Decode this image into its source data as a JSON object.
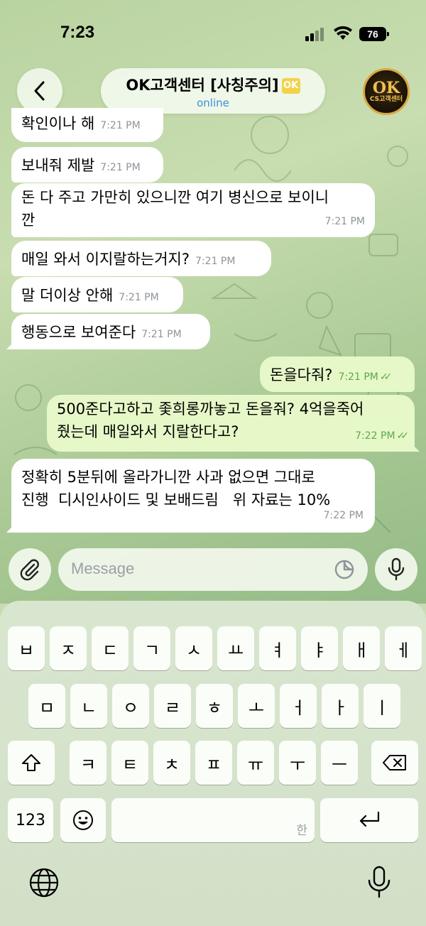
{
  "status_bar": {
    "time": "7:23",
    "battery": "76"
  },
  "header": {
    "title": "OK고객센터 [사칭주의]",
    "status": "online",
    "avatar_text": "OK",
    "avatar_sub": "CS고객센터"
  },
  "messages": [
    {
      "direction": "in",
      "text": "확인이나 해",
      "time": "7:21 PM"
    },
    {
      "direction": "in",
      "text": "보내줘 제발",
      "time": "7:21 PM"
    },
    {
      "direction": "in",
      "text": "돈 다 주고 가만히 있으니깐 여기 병신으로 보이니\n깐",
      "time": "7:21 PM"
    },
    {
      "direction": "in",
      "text": "매일 와서 이지랄하는거지?",
      "time": "7:21 PM"
    },
    {
      "direction": "in",
      "text": "말 더이상 안해",
      "time": "7:21 PM"
    },
    {
      "direction": "in",
      "text": "행동으로 보여준다",
      "time": "7:21 PM"
    },
    {
      "direction": "out",
      "text": "돈을다줘?",
      "time": "7:21 PM"
    },
    {
      "direction": "out",
      "text": "500준다고하고 좇희롱까놓고 돈을줘? 4억을죽어\n줬는데 매일와서 지랄한다고?",
      "time": "7:22 PM"
    },
    {
      "direction": "in",
      "text": "정확히 5분뒤에 올라가니깐 사과 없으면 그대로\n진행  디시인사이드 및 보배드림   위 자료는 10%",
      "time": "7:22 PM"
    }
  ],
  "input": {
    "placeholder": "Message"
  },
  "keyboard": {
    "row1": [
      "ㅂ",
      "ㅈ",
      "ㄷ",
      "ㄱ",
      "ㅅ",
      "ㅛ",
      "ㅕ",
      "ㅑ",
      "ㅐ",
      "ㅔ"
    ],
    "row2": [
      "ㅁ",
      "ㄴ",
      "ㅇ",
      "ㄹ",
      "ㅎ",
      "ㅗ",
      "ㅓ",
      "ㅏ",
      "ㅣ"
    ],
    "row3": [
      "ㅋ",
      "ㅌ",
      "ㅊ",
      "ㅍ",
      "ㅠ",
      "ㅜ",
      "ㅡ"
    ],
    "numbers_label": "123",
    "space_hint": "한"
  },
  "colors": {
    "outgoing_bubble": "#e6f8c8",
    "incoming_bubble": "#ffffff",
    "online": "#3a8fd8",
    "tick": "#5da84a"
  }
}
